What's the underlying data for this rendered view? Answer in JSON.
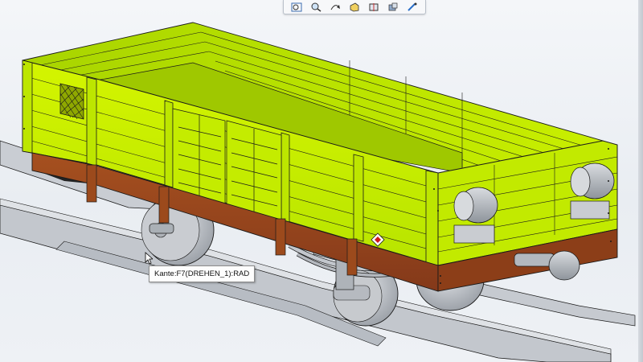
{
  "toolbar": {
    "items": [
      {
        "icon": "zoom-fit-icon",
        "label": ""
      },
      {
        "icon": "zoom-area-icon",
        "label": ""
      },
      {
        "icon": "rotate-view-icon",
        "label": ""
      },
      {
        "icon": "view-orientation-icon",
        "label": ""
      },
      {
        "icon": "section-view-icon",
        "label": ""
      },
      {
        "icon": "display-style-icon",
        "label": ""
      },
      {
        "icon": "sketch-tool-icon",
        "label": ""
      }
    ]
  },
  "tooltip": {
    "text": "Kante:F7(DREHEN_1):RAD"
  },
  "colors": {
    "body_green": "#c8f000",
    "body_green_dark": "#9fc800",
    "frame_brown": "#a04a1e",
    "frame_brown_dark": "#7a3414",
    "metal_grey": "#b8bcc2",
    "rail_grey": "#9aa0a8",
    "edge_black": "#1a1a1a"
  }
}
